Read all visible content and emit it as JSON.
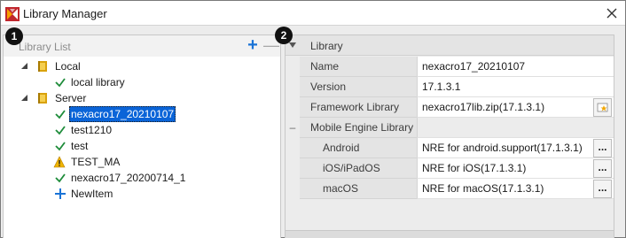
{
  "window": {
    "title": "Library Manager"
  },
  "badges": {
    "left": "1",
    "right": "2"
  },
  "library_list": {
    "title": "Library List",
    "add_label": "+",
    "remove_label": "—",
    "groups": [
      {
        "label": "Local",
        "items": [
          {
            "label": "local library",
            "status": "ok"
          }
        ]
      },
      {
        "label": "Server",
        "items": [
          {
            "label": "nexacro17_20210107",
            "status": "ok",
            "selected": true
          },
          {
            "label": "test1210",
            "status": "ok"
          },
          {
            "label": "test",
            "status": "ok"
          },
          {
            "label": "TEST_MA",
            "status": "warning"
          },
          {
            "label": "nexacro17_20200714_1",
            "status": "ok"
          },
          {
            "label": "NewItem",
            "status": "new"
          }
        ]
      }
    ]
  },
  "properties": {
    "section_title": "Library",
    "rows": [
      {
        "name": "Name",
        "value": "nexacro17_20210107"
      },
      {
        "name": "Version",
        "value": "17.1.3.1"
      },
      {
        "name": "Framework Library",
        "value": "nexacro17lib.zip(17.1.3.1)",
        "button": "folder-star"
      },
      {
        "name": "Mobile Engine Library",
        "value": "",
        "group_toggle": "–"
      },
      {
        "name": "Android",
        "value": "NRE for android.support(17.1.3.1)",
        "button": "..."
      },
      {
        "name": "iOS/iPadOS",
        "value": "NRE for iOS(17.1.3.1)",
        "button": "..."
      },
      {
        "name": "macOS",
        "value": "NRE for macOS(17.1.3.1)",
        "button": "..."
      }
    ]
  },
  "colors": {
    "accent": "#0a64d8",
    "check": "#1e8c3a",
    "warning": "#f0b400",
    "add": "#1a73d6"
  }
}
